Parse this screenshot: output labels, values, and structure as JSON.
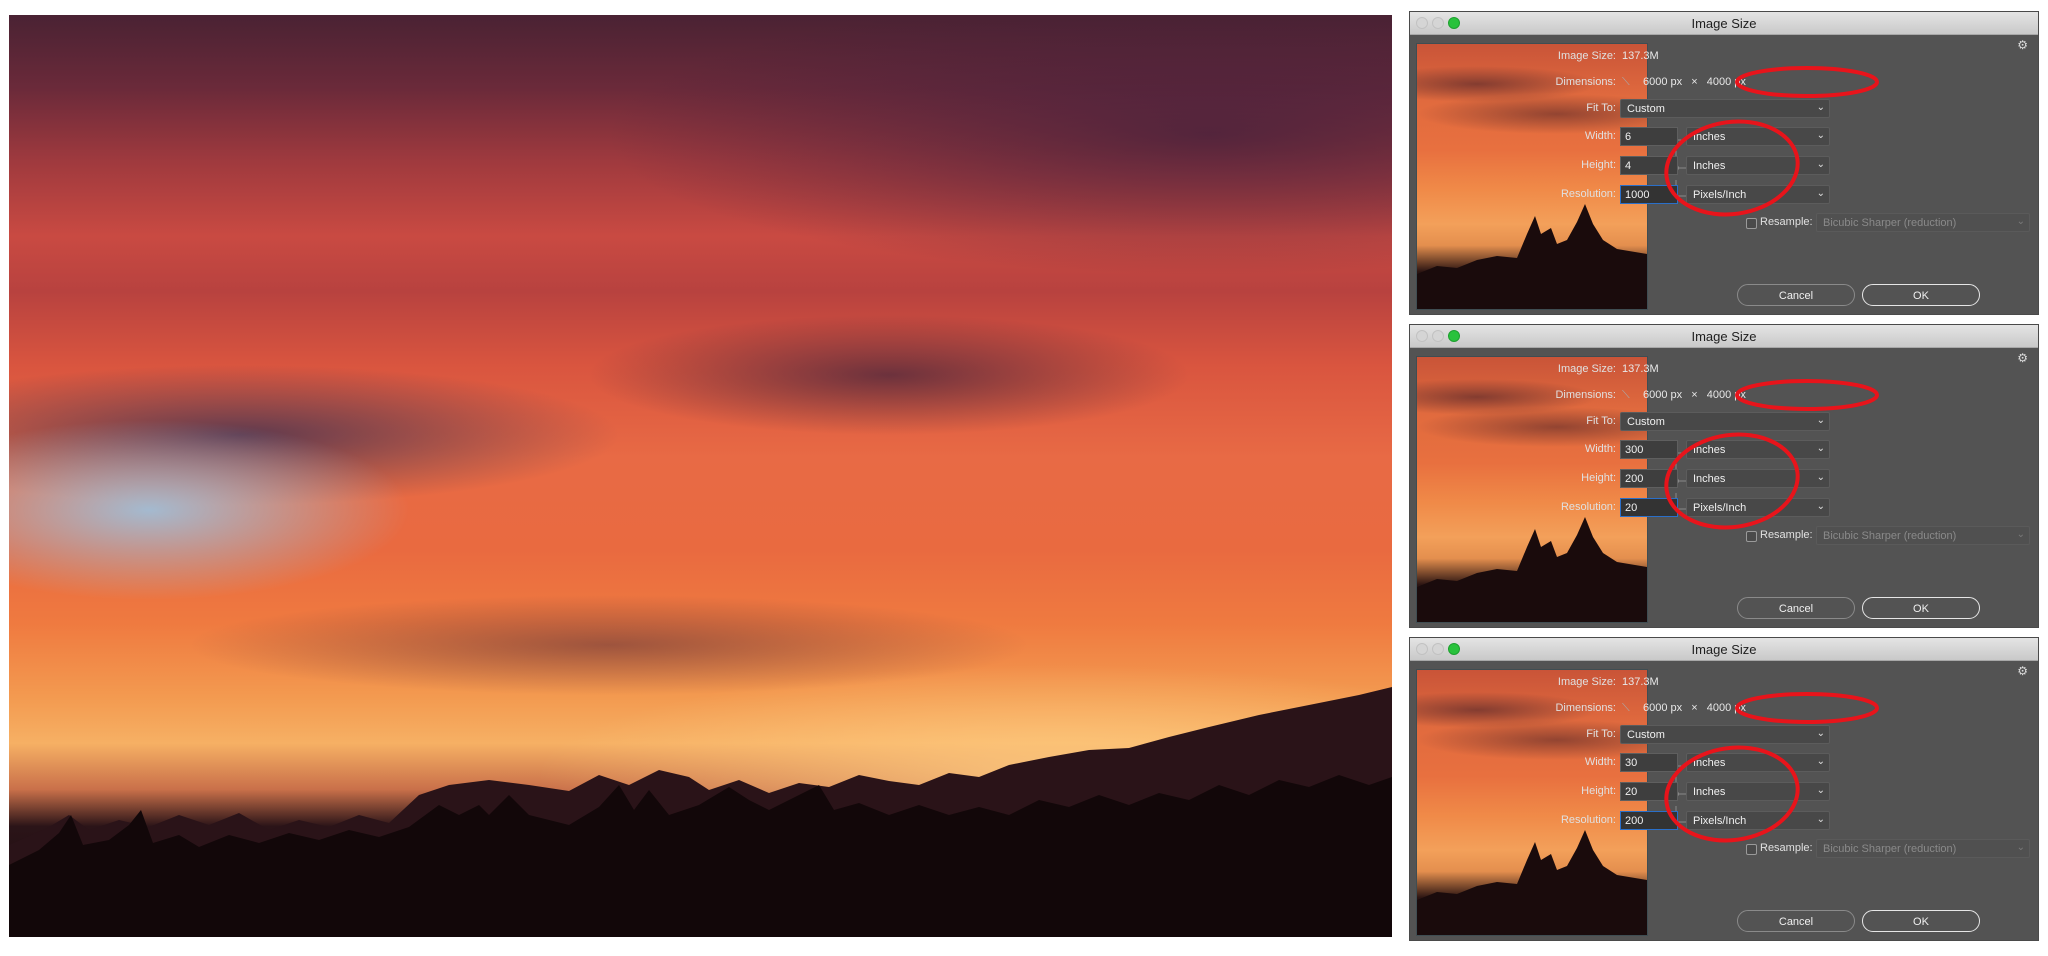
{
  "photo": {
    "description": "Sunset sky over forested mountain silhouette"
  },
  "dialogs": [
    {
      "title": "Image Size",
      "image_size_label": "Image Size:",
      "image_size_value": "137.3M",
      "dimensions_label": "Dimensions:",
      "dimensions_width": "6000 px",
      "dimensions_times": "×",
      "dimensions_height": "4000 px",
      "fit_to_label": "Fit To:",
      "fit_to_value": "Custom",
      "width_label": "Width:",
      "width_value": "6",
      "width_unit": "Inches",
      "height_label": "Height:",
      "height_value": "4",
      "height_unit": "Inches",
      "resolution_label": "Resolution:",
      "resolution_value": "1000",
      "resolution_unit": "Pixels/Inch",
      "resample_label": "Resample:",
      "resample_checked": false,
      "resample_value": "Bicubic Sharper (reduction)",
      "cancel_label": "Cancel",
      "ok_label": "OK"
    },
    {
      "title": "Image Size",
      "image_size_label": "Image Size:",
      "image_size_value": "137.3M",
      "dimensions_label": "Dimensions:",
      "dimensions_width": "6000 px",
      "dimensions_times": "×",
      "dimensions_height": "4000 px",
      "fit_to_label": "Fit To:",
      "fit_to_value": "Custom",
      "width_label": "Width:",
      "width_value": "300",
      "width_unit": "Inches",
      "height_label": "Height:",
      "height_value": "200",
      "height_unit": "Inches",
      "resolution_label": "Resolution:",
      "resolution_value": "20",
      "resolution_unit": "Pixels/Inch",
      "resample_label": "Resample:",
      "resample_checked": false,
      "resample_value": "Bicubic Sharper (reduction)",
      "cancel_label": "Cancel",
      "ok_label": "OK"
    },
    {
      "title": "Image Size",
      "image_size_label": "Image Size:",
      "image_size_value": "137.3M",
      "dimensions_label": "Dimensions:",
      "dimensions_width": "6000 px",
      "dimensions_times": "×",
      "dimensions_height": "4000 px",
      "fit_to_label": "Fit To:",
      "fit_to_value": "Custom",
      "width_label": "Width:",
      "width_value": "30",
      "width_unit": "Inches",
      "height_label": "Height:",
      "height_value": "20",
      "height_unit": "Inches",
      "resolution_label": "Resolution:",
      "resolution_value": "200",
      "resolution_unit": "Pixels/Inch",
      "resample_label": "Resample:",
      "resample_checked": false,
      "resample_value": "Bicubic Sharper (reduction)",
      "cancel_label": "Cancel",
      "ok_label": "OK"
    }
  ],
  "icons": {
    "gear": "⚙",
    "chevron": "⌄",
    "dimensions_toggle": "⟍"
  },
  "colors": {
    "annotation_ring": "#e8141b",
    "dialog_bg": "#535353",
    "focus_blue": "#2a6fc9",
    "zoom_button": "#29c23c"
  }
}
